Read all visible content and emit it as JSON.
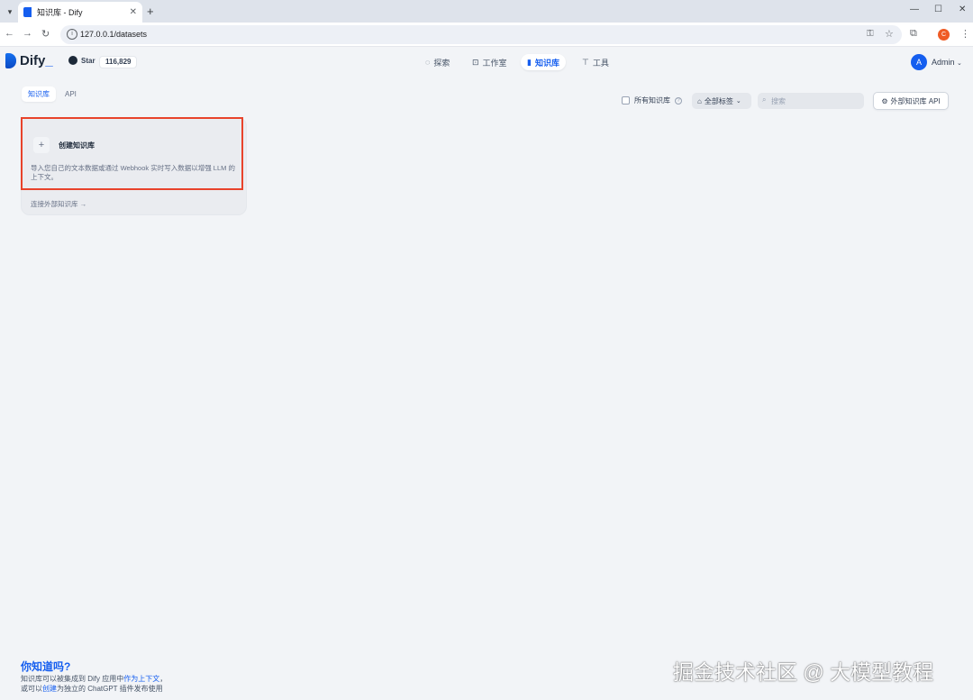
{
  "browser": {
    "tab_title": "知识库 - Dify",
    "url": "127.0.0.1/datasets",
    "window_controls": [
      "—",
      "☐",
      "✕"
    ],
    "profile_initial": "C"
  },
  "app": {
    "logo_text": "Dify",
    "logo_accent": "_",
    "github_label": "Star",
    "star_count": "116,829",
    "nav": [
      {
        "label": "探索",
        "icon": "compass-icon",
        "active": false
      },
      {
        "label": "工作室",
        "icon": "robot-icon",
        "active": false
      },
      {
        "label": "知识库",
        "icon": "book-icon",
        "active": true
      },
      {
        "label": "工具",
        "icon": "hammer-icon",
        "active": false
      }
    ],
    "user": {
      "initial": "A",
      "name": "Admin"
    },
    "accent_color": "#155eef"
  },
  "page": {
    "tabs": [
      {
        "label": "知识库",
        "active": true
      },
      {
        "label": "API",
        "active": false
      }
    ],
    "all_kb_label": "所有知识库",
    "tag_filter_label": "全部标签",
    "search_placeholder": "搜索",
    "external_api_label": "外部知识库 API",
    "create_card": {
      "title": "创建知识库",
      "description": "导入您自己的文本数据或通过 Webhook 实时写入数据以增强 LLM 的上下文。",
      "connect_label": "连接外部知识库"
    },
    "tip": {
      "title": "你知道吗?",
      "line1_a": "知识库可以被集成到 Dify 应用中",
      "line1_b": "作为上下文",
      "line1_c": "，",
      "line2_a": "或可以",
      "line2_b": "创建",
      "line2_c": "为独立的 ChatGPT 插件发布使用"
    }
  },
  "watermark": "掘金技术社区 @ 大模型教程"
}
